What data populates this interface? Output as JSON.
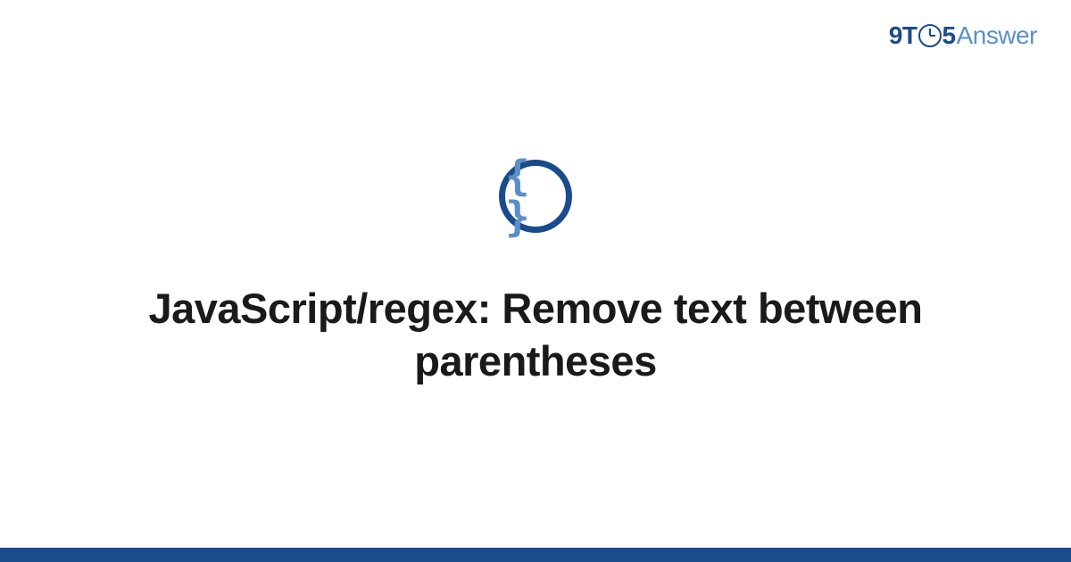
{
  "logo": {
    "part1": "9T",
    "part2": "5",
    "part3": "Answer"
  },
  "icon": {
    "braces": "{ }"
  },
  "title": "JavaScript/regex: Remove text between parentheses",
  "colors": {
    "primary": "#1a4b8c",
    "secondary": "#5a8fc7",
    "text": "#1a1a1a"
  }
}
